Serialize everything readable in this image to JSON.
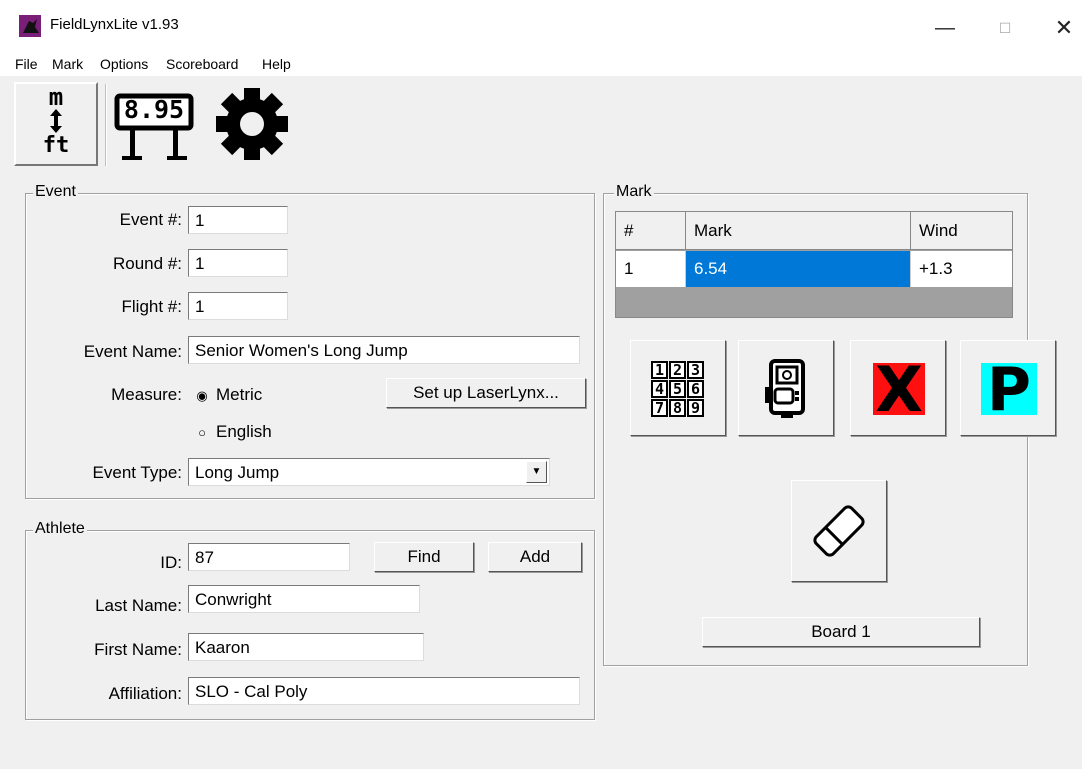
{
  "window": {
    "title": "FieldLynxLite  v1.93",
    "minimize_glyph": "—",
    "maximize_glyph": "☐",
    "close_glyph": "✕"
  },
  "menu": [
    "File",
    "Mark",
    "Options",
    "Scoreboard",
    "Help"
  ],
  "toolbar": {
    "units_top": "m",
    "units_bottom": "ft",
    "scoreboard_value": "8.95",
    "settings_icon": "gear-icon"
  },
  "event": {
    "group_label": "Event",
    "event_no_label": "Event #:",
    "event_no": "1",
    "round_no_label": "Round #:",
    "round_no": "1",
    "flight_no_label": "Flight #:",
    "flight_no": "1",
    "event_name_label": "Event Name:",
    "event_name": "Senior Women's Long Jump",
    "measure_label": "Measure:",
    "measure_metric": "Metric",
    "measure_english": "English",
    "measure_selected": "Metric",
    "laser_button": "Set up LaserLynx...",
    "event_type_label": "Event Type:",
    "event_type": "Long Jump"
  },
  "athlete": {
    "group_label": "Athlete",
    "id_label": "ID:",
    "id": "87",
    "find_button": "Find",
    "add_button": "Add",
    "last_name_label": "Last Name:",
    "last_name": "Conwright",
    "first_name_label": "First Name:",
    "first_name": "Kaaron",
    "affiliation_label": "Affiliation:",
    "affiliation": "SLO - Cal Poly"
  },
  "mark": {
    "group_label": "Mark",
    "columns": [
      "#",
      "Mark",
      "Wind"
    ],
    "rows": [
      {
        "num": "1",
        "mark": "6.54",
        "wind": "+1.3"
      }
    ],
    "keypad_digits": [
      "1",
      "2",
      "3",
      "4",
      "5",
      "6",
      "7",
      "8",
      "9"
    ],
    "foul_letter": "X",
    "pass_letter": "P",
    "board_button": "Board 1",
    "colors": {
      "foul_bg": "#ff1010",
      "pass_bg": "#00ffff",
      "selection": "#0078d7"
    }
  }
}
